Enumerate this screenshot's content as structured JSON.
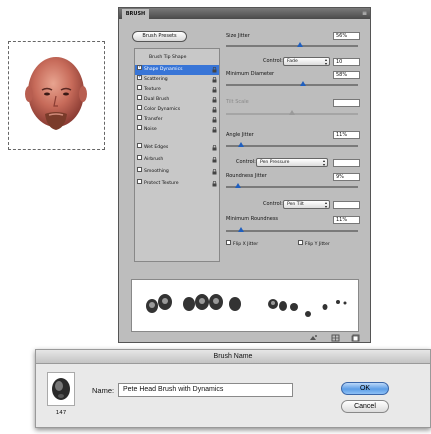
{
  "panel": {
    "tab_label": "BRUSH",
    "menu_glyph": "≡",
    "presets_button": "Brush Presets",
    "tip_list": [
      {
        "label": "Brush Tip Shape",
        "checked": null,
        "selected": false,
        "locked": false
      },
      {
        "label": "Shape Dynamics",
        "checked": true,
        "selected": true,
        "locked": true
      },
      {
        "label": "Scattering",
        "checked": true,
        "selected": false,
        "locked": true
      },
      {
        "label": "Texture",
        "checked": false,
        "selected": false,
        "locked": true
      },
      {
        "label": "Dual Brush",
        "checked": false,
        "selected": false,
        "locked": true
      },
      {
        "label": "Color Dynamics",
        "checked": false,
        "selected": false,
        "locked": true
      },
      {
        "label": "Transfer",
        "checked": false,
        "selected": false,
        "locked": true
      },
      {
        "label": "Noise",
        "checked": false,
        "selected": false,
        "locked": true
      },
      {
        "label": "Wet Edges",
        "checked": false,
        "selected": false,
        "locked": true
      },
      {
        "label": "Airbrush",
        "checked": false,
        "selected": false,
        "locked": true
      },
      {
        "label": "Smoothing",
        "checked": false,
        "selected": false,
        "locked": true
      },
      {
        "label": "Protect Texture",
        "checked": false,
        "selected": false,
        "locked": true
      }
    ],
    "size_jitter": {
      "label": "Size Jitter",
      "value": "56%",
      "level": 0.56
    },
    "control_1": {
      "label": "Control:",
      "option": "Fade",
      "value": "10"
    },
    "min_diameter": {
      "label": "Minimum Diameter",
      "value": "58%",
      "level": 0.58
    },
    "tilt_scale": {
      "label": "Tilt Scale",
      "value": "",
      "level": 0.5
    },
    "angle_jitter": {
      "label": "Angle Jitter",
      "value": "11%",
      "level": 0.11
    },
    "control_2": {
      "label": "Control:",
      "option": "Pen Pressure",
      "value": ""
    },
    "roundness_jitter": {
      "label": "Roundness Jitter",
      "value": "9%",
      "level": 0.09
    },
    "control_3": {
      "label": "Control:",
      "option": "Pen Tilt",
      "value": ""
    },
    "min_roundness": {
      "label": "Minimum Roundness",
      "value": "11%",
      "level": 0.11
    },
    "flip_x": {
      "label": "Flip X Jitter",
      "checked": false
    },
    "flip_y": {
      "label": "Flip Y Jitter",
      "checked": false
    },
    "footer_icons": [
      "toggle-preview-icon",
      "grid-icon",
      "new-brush-icon"
    ]
  },
  "dialog": {
    "title": "Brush Name",
    "thumb_count": "147",
    "name_label": "Name:",
    "name_value": "Pete Head Brush with Dynamics",
    "ok_label": "OK",
    "cancel_label": "Cancel"
  },
  "colors": {
    "selection": "#3875d7",
    "slider_thumb": "#1f5fbf",
    "ok_button": "#5d9ee6"
  }
}
